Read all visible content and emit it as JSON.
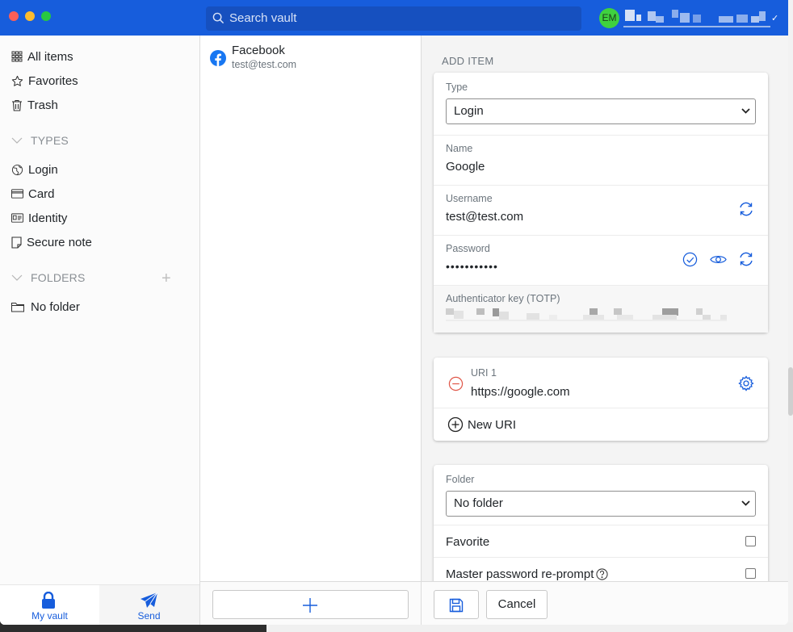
{
  "titlebar": {
    "search_placeholder": "Search vault",
    "avatar_initials": "EM",
    "avatar_color": "#3fd13f",
    "accent_color": "#175ddc"
  },
  "sidebar": {
    "items": [
      {
        "label": "All items",
        "icon": "grid-icon"
      },
      {
        "label": "Favorites",
        "icon": "star-icon"
      },
      {
        "label": "Trash",
        "icon": "trash-icon"
      }
    ],
    "types_header": "TYPES",
    "types": [
      {
        "label": "Login",
        "icon": "globe-icon"
      },
      {
        "label": "Card",
        "icon": "credit-card-icon"
      },
      {
        "label": "Identity",
        "icon": "id-card-icon"
      },
      {
        "label": "Secure note",
        "icon": "note-icon"
      }
    ],
    "folders_header": "FOLDERS",
    "folders": [
      {
        "label": "No folder",
        "icon": "folder-icon"
      }
    ],
    "tabs": [
      {
        "label": "My vault",
        "icon": "lock-icon"
      },
      {
        "label": "Send",
        "icon": "paper-plane-icon"
      }
    ]
  },
  "list": {
    "items": [
      {
        "name": "Facebook",
        "subtitle": "test@test.com",
        "icon": "facebook-icon"
      }
    ]
  },
  "detail": {
    "section_title": "ADD ITEM",
    "type_label": "Type",
    "type_value": "Login",
    "name_label": "Name",
    "name_value": "Google",
    "username_label": "Username",
    "username_value": "test@test.com",
    "password_label": "Password",
    "password_value": "•••••••••••",
    "totp_label": "Authenticator key (TOTP)",
    "uri_label": "URI 1",
    "uri_value": "https://google.com",
    "new_uri_label": "New URI",
    "folder_label": "Folder",
    "folder_value": "No folder",
    "favorite_label": "Favorite",
    "reprompt_label": "Master password re-prompt",
    "cancel_label": "Cancel"
  }
}
